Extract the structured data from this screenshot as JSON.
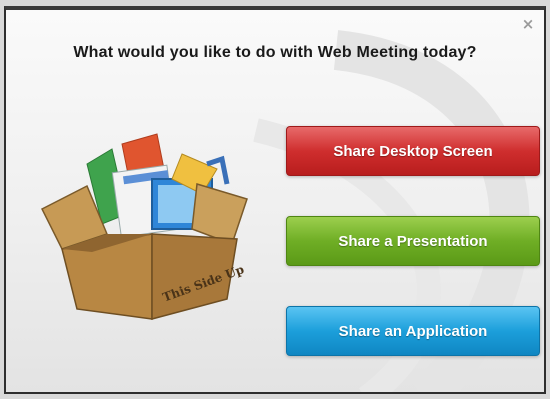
{
  "dialog": {
    "title": "What would you like to do with Web Meeting today?",
    "close_glyph": "×",
    "box_label": "This Side Up",
    "actions": [
      {
        "label": "Share Desktop Screen",
        "color": "#cf2e2e"
      },
      {
        "label": "Share a Presentation",
        "color": "#6fae25"
      },
      {
        "label": "Share an Application",
        "color": "#1c9fdb"
      }
    ]
  }
}
